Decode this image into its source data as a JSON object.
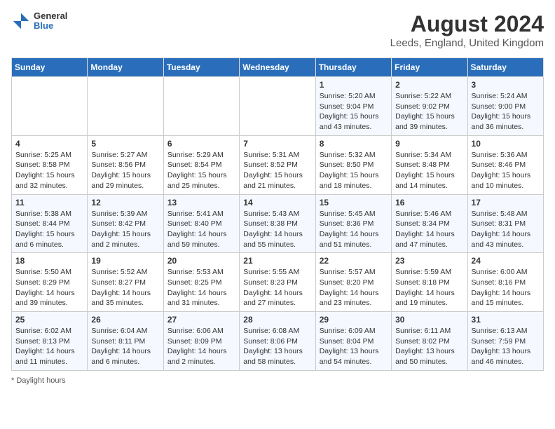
{
  "logo": {
    "general": "General",
    "blue": "Blue"
  },
  "title": "August 2024",
  "subtitle": "Leeds, England, United Kingdom",
  "footer": "Daylight hours",
  "days_of_week": [
    "Sunday",
    "Monday",
    "Tuesday",
    "Wednesday",
    "Thursday",
    "Friday",
    "Saturday"
  ],
  "weeks": [
    [
      {
        "day": "",
        "info": ""
      },
      {
        "day": "",
        "info": ""
      },
      {
        "day": "",
        "info": ""
      },
      {
        "day": "",
        "info": ""
      },
      {
        "day": "1",
        "info": "Sunrise: 5:20 AM\nSunset: 9:04 PM\nDaylight: 15 hours\nand 43 minutes."
      },
      {
        "day": "2",
        "info": "Sunrise: 5:22 AM\nSunset: 9:02 PM\nDaylight: 15 hours\nand 39 minutes."
      },
      {
        "day": "3",
        "info": "Sunrise: 5:24 AM\nSunset: 9:00 PM\nDaylight: 15 hours\nand 36 minutes."
      }
    ],
    [
      {
        "day": "4",
        "info": "Sunrise: 5:25 AM\nSunset: 8:58 PM\nDaylight: 15 hours\nand 32 minutes."
      },
      {
        "day": "5",
        "info": "Sunrise: 5:27 AM\nSunset: 8:56 PM\nDaylight: 15 hours\nand 29 minutes."
      },
      {
        "day": "6",
        "info": "Sunrise: 5:29 AM\nSunset: 8:54 PM\nDaylight: 15 hours\nand 25 minutes."
      },
      {
        "day": "7",
        "info": "Sunrise: 5:31 AM\nSunset: 8:52 PM\nDaylight: 15 hours\nand 21 minutes."
      },
      {
        "day": "8",
        "info": "Sunrise: 5:32 AM\nSunset: 8:50 PM\nDaylight: 15 hours\nand 18 minutes."
      },
      {
        "day": "9",
        "info": "Sunrise: 5:34 AM\nSunset: 8:48 PM\nDaylight: 15 hours\nand 14 minutes."
      },
      {
        "day": "10",
        "info": "Sunrise: 5:36 AM\nSunset: 8:46 PM\nDaylight: 15 hours\nand 10 minutes."
      }
    ],
    [
      {
        "day": "11",
        "info": "Sunrise: 5:38 AM\nSunset: 8:44 PM\nDaylight: 15 hours\nand 6 minutes."
      },
      {
        "day": "12",
        "info": "Sunrise: 5:39 AM\nSunset: 8:42 PM\nDaylight: 15 hours\nand 2 minutes."
      },
      {
        "day": "13",
        "info": "Sunrise: 5:41 AM\nSunset: 8:40 PM\nDaylight: 14 hours\nand 59 minutes."
      },
      {
        "day": "14",
        "info": "Sunrise: 5:43 AM\nSunset: 8:38 PM\nDaylight: 14 hours\nand 55 minutes."
      },
      {
        "day": "15",
        "info": "Sunrise: 5:45 AM\nSunset: 8:36 PM\nDaylight: 14 hours\nand 51 minutes."
      },
      {
        "day": "16",
        "info": "Sunrise: 5:46 AM\nSunset: 8:34 PM\nDaylight: 14 hours\nand 47 minutes."
      },
      {
        "day": "17",
        "info": "Sunrise: 5:48 AM\nSunset: 8:31 PM\nDaylight: 14 hours\nand 43 minutes."
      }
    ],
    [
      {
        "day": "18",
        "info": "Sunrise: 5:50 AM\nSunset: 8:29 PM\nDaylight: 14 hours\nand 39 minutes."
      },
      {
        "day": "19",
        "info": "Sunrise: 5:52 AM\nSunset: 8:27 PM\nDaylight: 14 hours\nand 35 minutes."
      },
      {
        "day": "20",
        "info": "Sunrise: 5:53 AM\nSunset: 8:25 PM\nDaylight: 14 hours\nand 31 minutes."
      },
      {
        "day": "21",
        "info": "Sunrise: 5:55 AM\nSunset: 8:23 PM\nDaylight: 14 hours\nand 27 minutes."
      },
      {
        "day": "22",
        "info": "Sunrise: 5:57 AM\nSunset: 8:20 PM\nDaylight: 14 hours\nand 23 minutes."
      },
      {
        "day": "23",
        "info": "Sunrise: 5:59 AM\nSunset: 8:18 PM\nDaylight: 14 hours\nand 19 minutes."
      },
      {
        "day": "24",
        "info": "Sunrise: 6:00 AM\nSunset: 8:16 PM\nDaylight: 14 hours\nand 15 minutes."
      }
    ],
    [
      {
        "day": "25",
        "info": "Sunrise: 6:02 AM\nSunset: 8:13 PM\nDaylight: 14 hours\nand 11 minutes."
      },
      {
        "day": "26",
        "info": "Sunrise: 6:04 AM\nSunset: 8:11 PM\nDaylight: 14 hours\nand 6 minutes."
      },
      {
        "day": "27",
        "info": "Sunrise: 6:06 AM\nSunset: 8:09 PM\nDaylight: 14 hours\nand 2 minutes."
      },
      {
        "day": "28",
        "info": "Sunrise: 6:08 AM\nSunset: 8:06 PM\nDaylight: 13 hours\nand 58 minutes."
      },
      {
        "day": "29",
        "info": "Sunrise: 6:09 AM\nSunset: 8:04 PM\nDaylight: 13 hours\nand 54 minutes."
      },
      {
        "day": "30",
        "info": "Sunrise: 6:11 AM\nSunset: 8:02 PM\nDaylight: 13 hours\nand 50 minutes."
      },
      {
        "day": "31",
        "info": "Sunrise: 6:13 AM\nSunset: 7:59 PM\nDaylight: 13 hours\nand 46 minutes."
      }
    ]
  ]
}
